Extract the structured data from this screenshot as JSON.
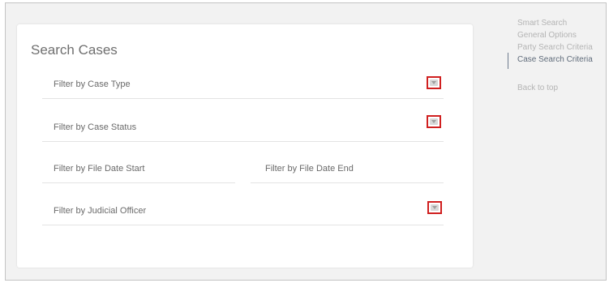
{
  "card": {
    "title": "Search Cases"
  },
  "filters": {
    "case_type": {
      "label": "Filter by Case Type",
      "has_dropdown": true
    },
    "case_status": {
      "label": "Filter by Case Status",
      "has_dropdown": true
    },
    "file_date_start": {
      "label": "Filter by File Date Start"
    },
    "file_date_end": {
      "label": "Filter by File Date End"
    },
    "judicial_officer": {
      "label": "Filter by Judicial Officer",
      "has_dropdown": true
    }
  },
  "nav": {
    "items": [
      {
        "label": "Smart Search",
        "active": false
      },
      {
        "label": "General Options",
        "active": false
      },
      {
        "label": "Party Search Criteria",
        "active": false
      },
      {
        "label": "Case Search Criteria",
        "active": true
      }
    ],
    "back_to_top": "Back to top"
  },
  "colors": {
    "highlight_border": "#d02020",
    "frame_background": "#f2f2f2",
    "active_nav": "#5f6b7a",
    "inactive_nav": "#b4b4b4"
  },
  "icons": {
    "dropdown": "chevron-down-icon"
  }
}
